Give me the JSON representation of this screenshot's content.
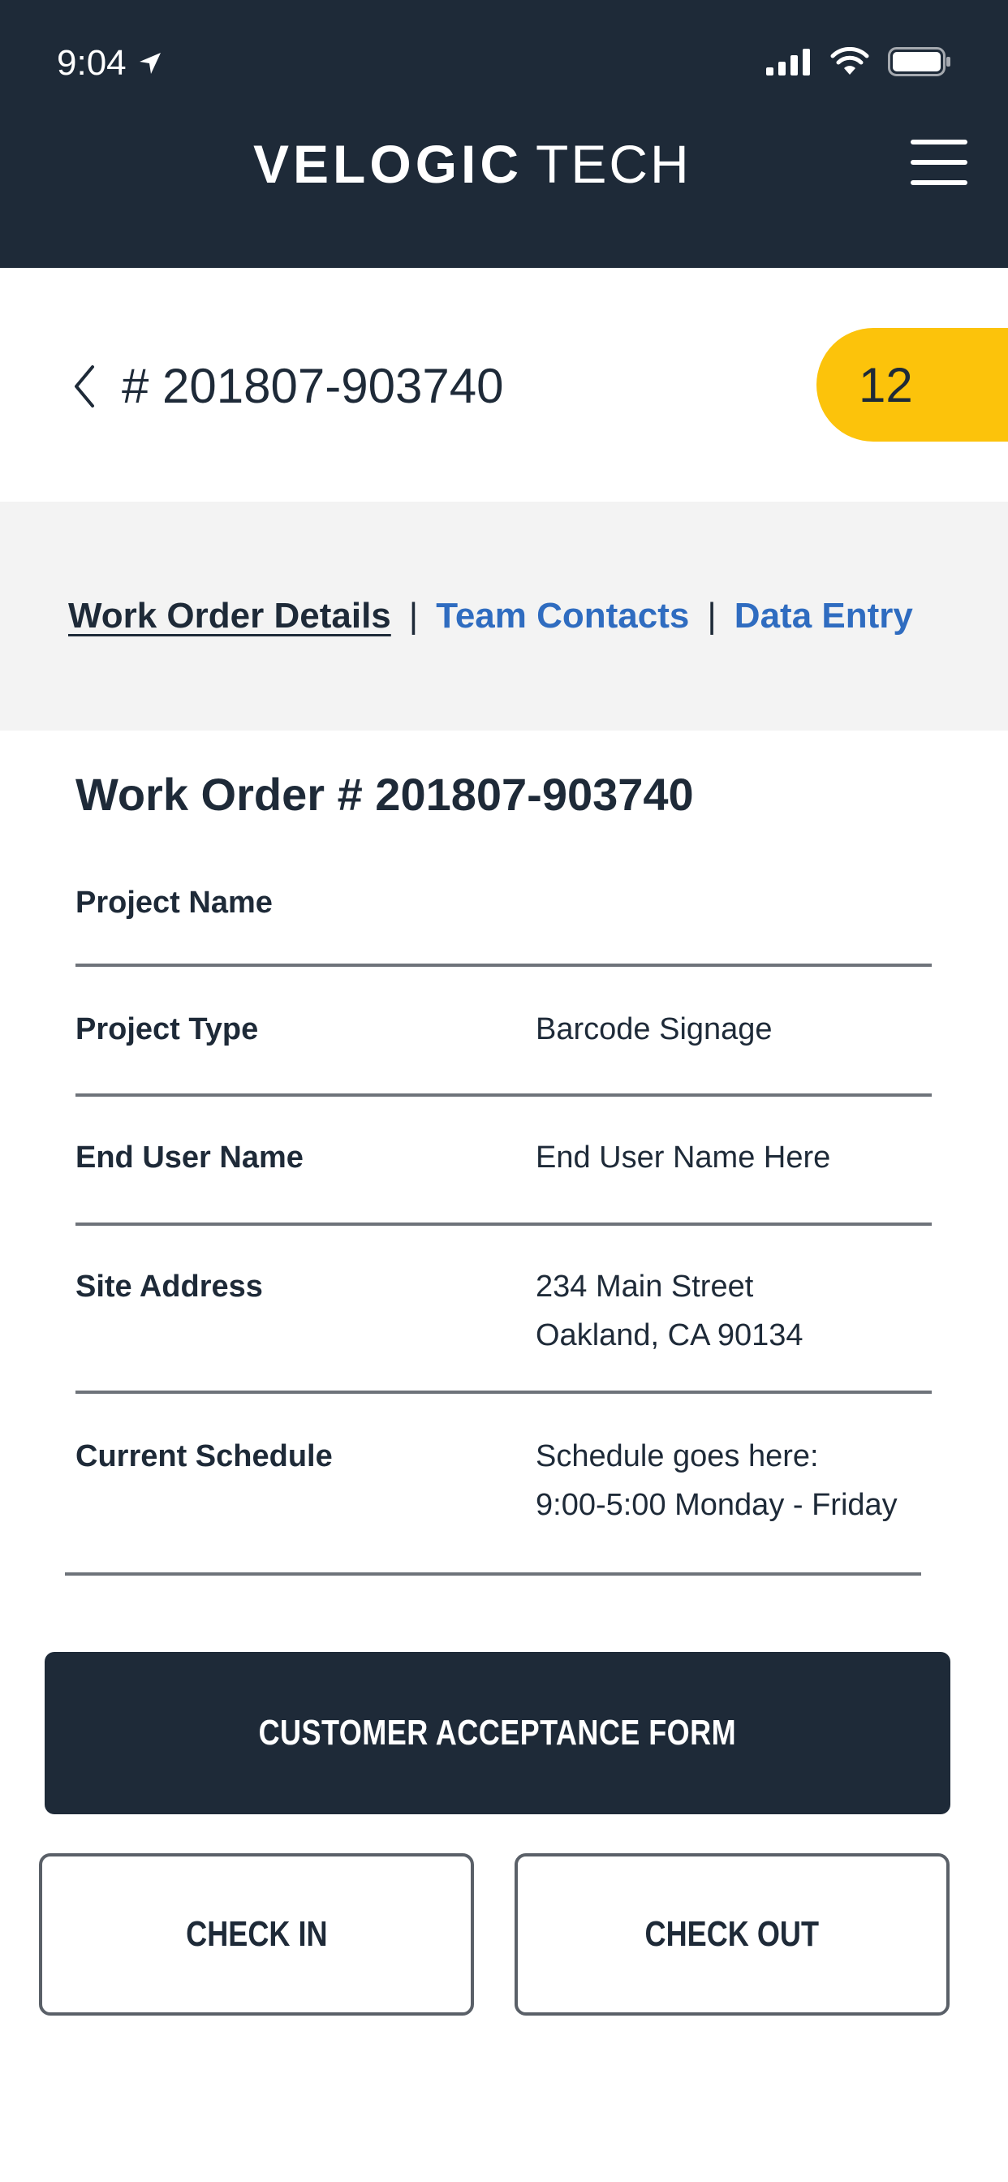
{
  "status_bar": {
    "time": "9:04"
  },
  "header": {
    "brand_bold": "VELOGIC",
    "brand_light": "TECH"
  },
  "title_row": {
    "order_title": "# 201807-903740",
    "badge_count": "12",
    "badge_color": "#fcc30b"
  },
  "tabs": [
    {
      "label": "Work Order Details",
      "active": true
    },
    {
      "label": "Team Contacts",
      "active": false
    },
    {
      "label": "Data Entry",
      "active": false
    }
  ],
  "tab_separator": "|",
  "details": {
    "title": "Work Order # 201807-903740",
    "rows": [
      {
        "label": "Project Name",
        "value": ""
      },
      {
        "label": "Project Type",
        "value": "Barcode Signage"
      },
      {
        "label": "End User Name",
        "value": "End User Name Here"
      },
      {
        "label": "Site Address",
        "value_line1": "234 Main Street",
        "value_line2": "Oakland, CA 90134"
      },
      {
        "label": "Current Schedule",
        "value_line1": "Schedule goes here:",
        "value_line2": "9:00-5:00 Monday - Friday"
      }
    ]
  },
  "actions": {
    "primary_label": "CUSTOMER ACCEPTANCE FORM",
    "check_in_label": "CHECK IN",
    "check_out_label": "CHECK OUT"
  },
  "colors": {
    "header_bg": "#1e2a38",
    "link": "#2f6cc0",
    "accent": "#fcc30b",
    "tab_bar_bg": "#f3f3f3"
  },
  "icons": [
    "location-arrow-icon",
    "cellular-signal-icon",
    "wifi-icon",
    "battery-icon",
    "hamburger-menu-icon",
    "chevron-left-icon"
  ]
}
